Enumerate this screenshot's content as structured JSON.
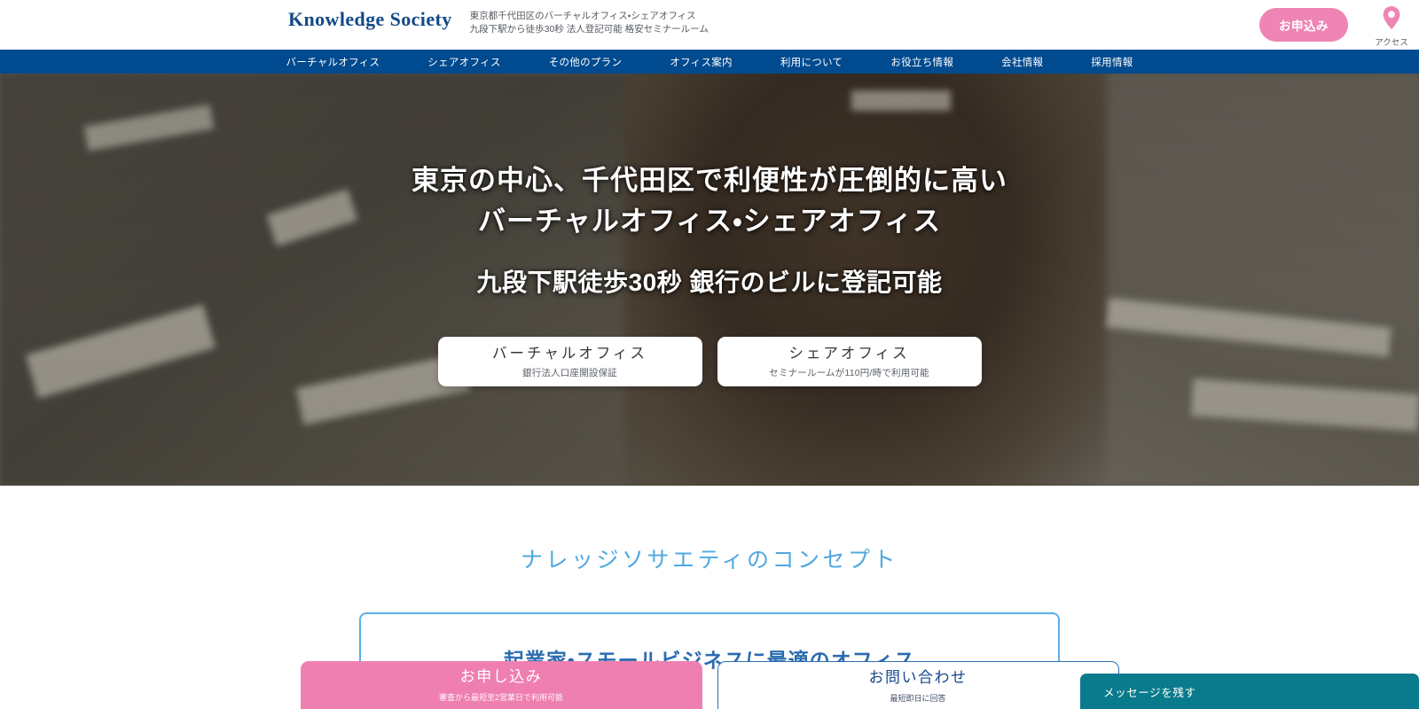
{
  "header": {
    "logo_text": "Knowledge Society",
    "tagline_line1": "東京都千代田区のバーチャルオフィス・シェアオフィス",
    "tagline_line2": "九段下駅から徒歩30秒 法人登記可能 格安セミナールーム",
    "apply_button": "お申込み",
    "access_label": "アクセス",
    "logo_color": "#134a86",
    "apply_button_color": "#ef85b4"
  },
  "nav": {
    "background_color": "#004a8f",
    "items": [
      {
        "label": "バーチャルオフィス"
      },
      {
        "label": "シェアオフィス"
      },
      {
        "label": "その他のプラン"
      },
      {
        "label": "オフィス案内"
      },
      {
        "label": "利用について"
      },
      {
        "label": "お役立ち情報"
      },
      {
        "label": "会社情報"
      },
      {
        "label": "採用情報"
      }
    ]
  },
  "hero": {
    "headline_line1": "東京の中心、千代田区で利便性が圧倒的に高い",
    "headline_line2": "バーチャルオフィス・シェアオフィス",
    "subheadline": "九段下駅徒歩30秒 銀行のビルに登記可能",
    "cards": [
      {
        "title": "バーチャルオフィス",
        "subtitle": "銀行法人口座開設保証"
      },
      {
        "title": "シェアオフィス",
        "subtitle": "セミナールームが110円/時で利用可能"
      }
    ]
  },
  "concept": {
    "section_title": "ナレッジソサエティのコンセプト",
    "section_title_color": "#4fa8e0",
    "box_title": "起業家・スモールビジネスに最適のオフィス",
    "box_border_color": "#59b0e8"
  },
  "bottom_bar": {
    "apply": {
      "title": "お申し込み",
      "subtitle": "審査から最短至2営業日で利用可能",
      "color": "#ef7fb0"
    },
    "contact": {
      "title": "お問い合わせ",
      "subtitle": "最短即日に回答",
      "border_color": "#2f6fb5"
    },
    "chat": {
      "label": "メッセージを残す",
      "color": "#0a7b8c"
    }
  }
}
